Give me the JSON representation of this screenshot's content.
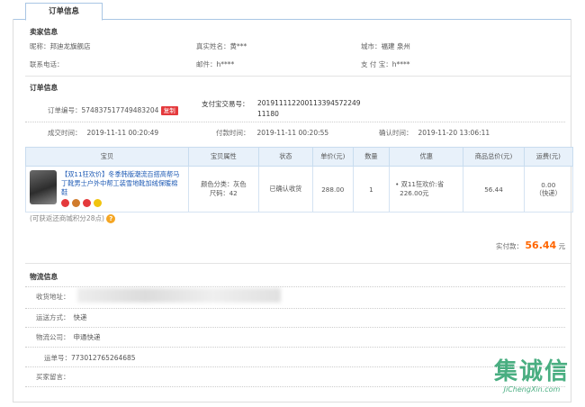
{
  "tab": {
    "label": "订单信息"
  },
  "seller": {
    "title": "卖家信息",
    "nickname_label": "昵称：",
    "nickname": "邦迪龙旗舰店",
    "realname_label": "真实姓名：",
    "realname": "黄***",
    "city_label": "城市：",
    "city": "福建 泉州",
    "phone_label": "联系电话：",
    "phone": "",
    "email_label": "邮件：",
    "email": "h****",
    "alipay_label": "支 付 宝：",
    "alipay": "h****"
  },
  "order": {
    "title": "订单信息",
    "order_no_label": "订单编号：",
    "order_no": "574837517749483204",
    "copy_badge": "复制",
    "alipay_trade_label": "支付宝交易号：",
    "alipay_trade_1": "201911112200113394572249",
    "alipay_trade_2": "11180",
    "created_label": "成交时间：",
    "created": "2019-11-11 00:20:49",
    "paid_label": "付款时间：",
    "paid": "2019-11-11 00:20:55",
    "confirm_label": "确认时间：",
    "confirm": "2019-11-20 13:06:11"
  },
  "table": {
    "headers": [
      "宝贝",
      "宝贝属性",
      "状态",
      "单价(元)",
      "数量",
      "优惠",
      "商品总价(元)",
      "运费(元)"
    ],
    "row": {
      "title": "【双11狂欢价】冬季韩版潮流百搭高帮马丁靴男士户外中帮工装雪地靴加绒保暖棉鞋",
      "attr_1": "颜色分类：灰色",
      "attr_2": "尺码：42",
      "status": "已确认收货",
      "price": "288.00",
      "qty": "1",
      "discount_1": "• 双11狂欢价:省",
      "discount_2": "226.00元",
      "total": "56.44",
      "ship_1": "0.00",
      "ship_2": "（快递）"
    }
  },
  "points_note": "(可获返还商城积分28点)",
  "pay": {
    "label": "实付款：",
    "amount": "56.44",
    "unit": "元",
    "color": "#ff6600"
  },
  "logistics": {
    "title": "物流信息",
    "address_label": "收货地址：",
    "method_label": "运送方式：",
    "method": "快递",
    "company_label": "物流公司：",
    "company": "申通快递",
    "tracking_label": "运单号：",
    "tracking": "773012765264685",
    "note_label": "买家留言：",
    "note": ""
  },
  "watermark": {
    "text": "集诚信",
    "url": "JiChengXin.com"
  },
  "colors": {
    "accent": "#a9c6e4",
    "header_bg": "#e8f1fa",
    "badge": "#e4393c",
    "watermark": "#2aa06c"
  }
}
